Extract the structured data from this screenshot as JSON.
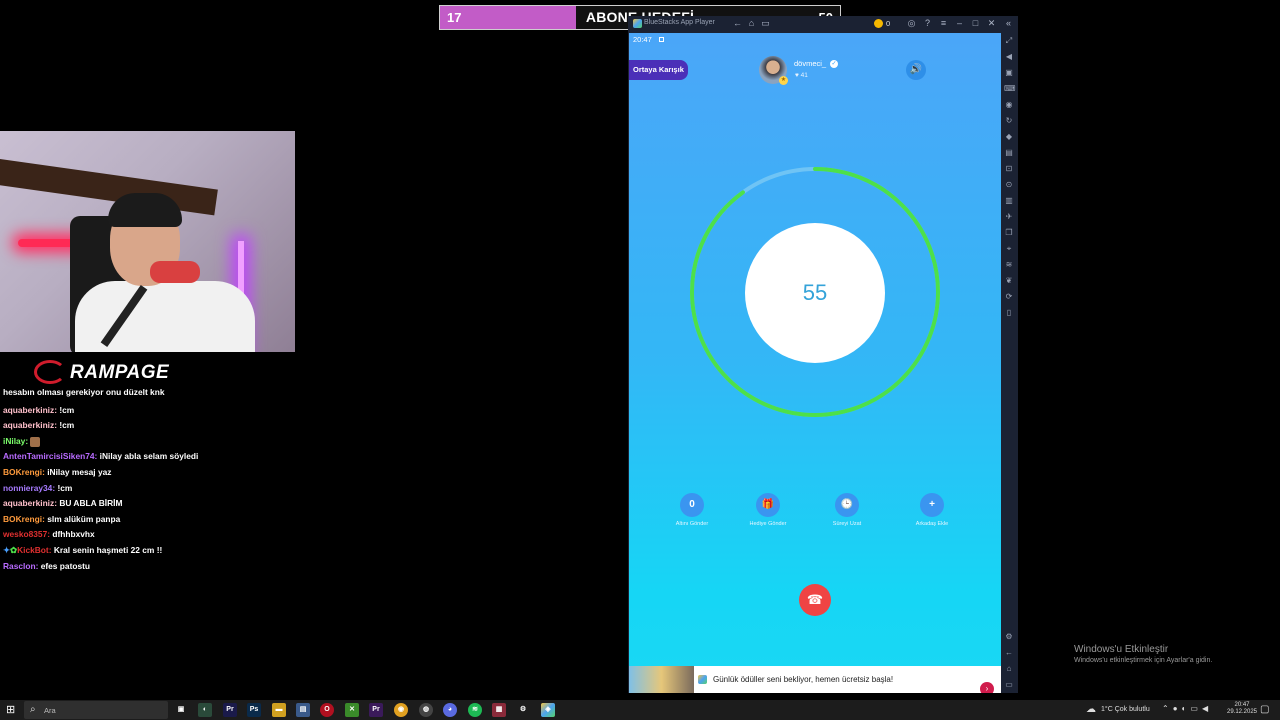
{
  "goal": {
    "current": "17",
    "title": "ABONE HEDEFİ",
    "target": "50",
    "progress": 0.34
  },
  "logo": {
    "text": "RAMPAGE"
  },
  "chat": [
    {
      "user": "",
      "text": "hesabın olması gerekiyor onu düzelt knk",
      "color": "#ffffff"
    },
    {
      "user": "aquaberkiniz:",
      "text": "!cm",
      "color": "#ffc0cb"
    },
    {
      "user": "aquaberkiniz:",
      "text": "!cm",
      "color": "#ffc0cb"
    },
    {
      "user": "iNilay:",
      "text": "",
      "color": "#7cff6b"
    },
    {
      "user": "AntenTamircisiSiken74:",
      "text": "iNilay abla selam söyledi",
      "color": "#b86bff"
    },
    {
      "user": "BOKrengi:",
      "text": "iNilay mesaj yaz",
      "color": "#ff9b3d"
    },
    {
      "user": "nonnieray34:",
      "text": "!cm",
      "color": "#a77bff"
    },
    {
      "user": "aquaberkiniz:",
      "text": "BU ABLA BİRİM",
      "color": "#ffc0cb"
    },
    {
      "user": "BOKrengi:",
      "text": "slm alüküm panpa",
      "color": "#ff9b3d"
    },
    {
      "user": "wesko8357:",
      "text": "dfhhbxvhx",
      "color": "#e03030"
    },
    {
      "user": "KickBot:",
      "text": "Kral senin haşmeti 22 cm !!",
      "color": "#e03030"
    },
    {
      "user": "Rasclon:",
      "text": "efes patostu",
      "color": "#b86bff"
    }
  ],
  "bluestacks": {
    "title": "BlueStacks App Player",
    "coins": "0"
  },
  "phone": {
    "time": "20:47",
    "mode": "Ortaya Karışık",
    "username": "dövmeci_",
    "hearts": "41",
    "timer": "55",
    "timer_progress": 0.9,
    "actions": [
      {
        "icon": "0",
        "label": "Altını Gönder"
      },
      {
        "icon": "🎁",
        "label": "Hediye Gönder"
      },
      {
        "icon": "🕒",
        "label": "Süreyi Uzat"
      },
      {
        "icon": "+",
        "label": "Arkadaş Ekle"
      }
    ],
    "ad": "Günlük ödüller seni bekliyor, hemen ücretsiz başla!"
  },
  "watermark": {
    "title": "Windows'u Etkinleştir",
    "subtitle": "Windows'u etkinleştirmek için Ayarlar'a gidin."
  },
  "taskbar": {
    "search_placeholder": "Ara",
    "weather": "1°C  Çok bulutlu",
    "time": "20:47",
    "date": "29.12.2025"
  },
  "colors": {
    "accent": "#c25cc7",
    "ring": "#4de04a",
    "hangup": "#ef4444",
    "phone_top": "#4ba6f8",
    "phone_bottom": "#1ad8f4"
  }
}
